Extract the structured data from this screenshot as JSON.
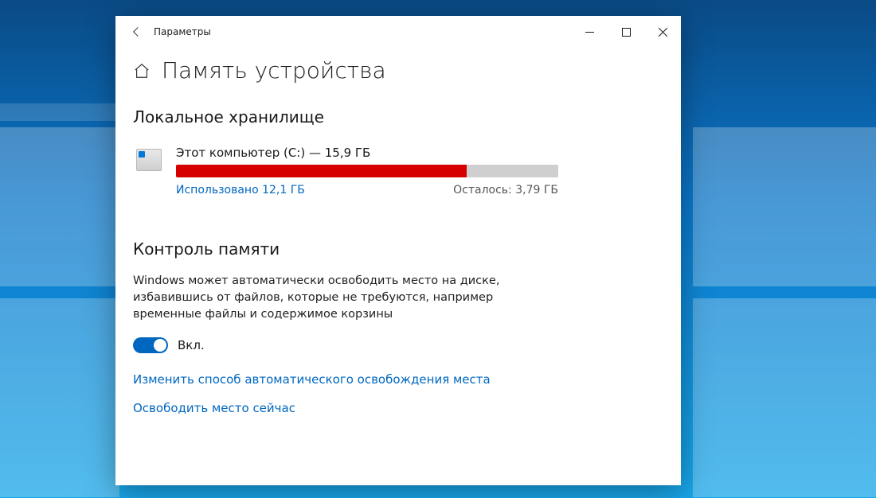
{
  "window": {
    "title": "Параметры"
  },
  "page": {
    "title": "Память устройства"
  },
  "local_storage": {
    "heading": "Локальное хранилище",
    "disk": {
      "label": "Этот компьютер (C:) — 15,9 ГБ",
      "used_text": "Использовано 12,1 ГБ",
      "remaining_text": "Осталось: 3,79 ГБ",
      "used_percent": 76
    }
  },
  "storage_sense": {
    "heading": "Контроль памяти",
    "description": "Windows может автоматически освободить место на диске, избавившись от файлов, которые не требуются, например временные файлы и содержимое корзины",
    "toggle_state": "Вкл.",
    "link_change": "Изменить способ автоматического освобождения места",
    "link_free_now": "Освободить место сейчас"
  }
}
